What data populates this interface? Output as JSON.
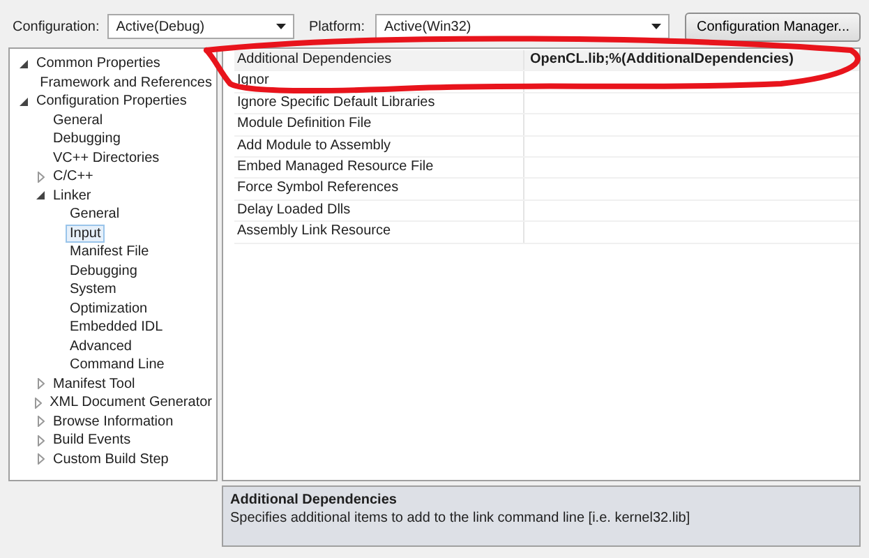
{
  "toolbar": {
    "configuration_label": "Configuration:",
    "configuration": "Active(Debug)",
    "platform_label": "Platform:",
    "platform": "Active(Win32)",
    "manager_button": "Configuration Manager..."
  },
  "tree": [
    {
      "label": "Common Properties",
      "expanded": true,
      "selected": false,
      "children": [
        {
          "label": "Framework and References",
          "selected": false
        }
      ]
    },
    {
      "label": "Configuration Properties",
      "expanded": true,
      "selected": false,
      "children": [
        {
          "label": "General",
          "selected": false
        },
        {
          "label": "Debugging",
          "selected": false
        },
        {
          "label": "VC++ Directories",
          "selected": false
        },
        {
          "label": "C/C++",
          "expanded": false,
          "selected": false
        },
        {
          "label": "Linker",
          "expanded": true,
          "selected": false,
          "children": [
            {
              "label": "General",
              "selected": false
            },
            {
              "label": "Input",
              "selected": true
            },
            {
              "label": "Manifest File",
              "selected": false
            },
            {
              "label": "Debugging",
              "selected": false
            },
            {
              "label": "System",
              "selected": false
            },
            {
              "label": "Optimization",
              "selected": false
            },
            {
              "label": "Embedded IDL",
              "selected": false
            },
            {
              "label": "Advanced",
              "selected": false
            },
            {
              "label": "Command Line",
              "selected": false
            }
          ]
        },
        {
          "label": "Manifest Tool",
          "expanded": false,
          "selected": false
        },
        {
          "label": "XML Document Generator",
          "expanded": false,
          "selected": false
        },
        {
          "label": "Browse Information",
          "expanded": false,
          "selected": false
        },
        {
          "label": "Build Events",
          "expanded": false,
          "selected": false
        },
        {
          "label": "Custom Build Step",
          "expanded": false,
          "selected": false
        }
      ]
    }
  ],
  "properties": [
    {
      "name": "Additional Dependencies",
      "value": "OpenCL.lib;%(AdditionalDependencies)",
      "selected": true
    },
    {
      "name": "Ignor",
      "selected": false
    },
    {
      "name": "Ignore Specific Default Libraries",
      "selected": false
    },
    {
      "name": "Module Definition File",
      "selected": false
    },
    {
      "name": "Add Module to Assembly",
      "selected": false
    },
    {
      "name": "Embed Managed Resource File",
      "selected": false
    },
    {
      "name": "Force Symbol References",
      "selected": false
    },
    {
      "name": "Delay Loaded Dlls",
      "selected": false
    },
    {
      "name": "Assembly Link Resource",
      "selected": false
    }
  ],
  "description": {
    "title": "Additional Dependencies",
    "text": "Specifies additional items to add to the link command line [i.e. kernel32.lib]"
  }
}
